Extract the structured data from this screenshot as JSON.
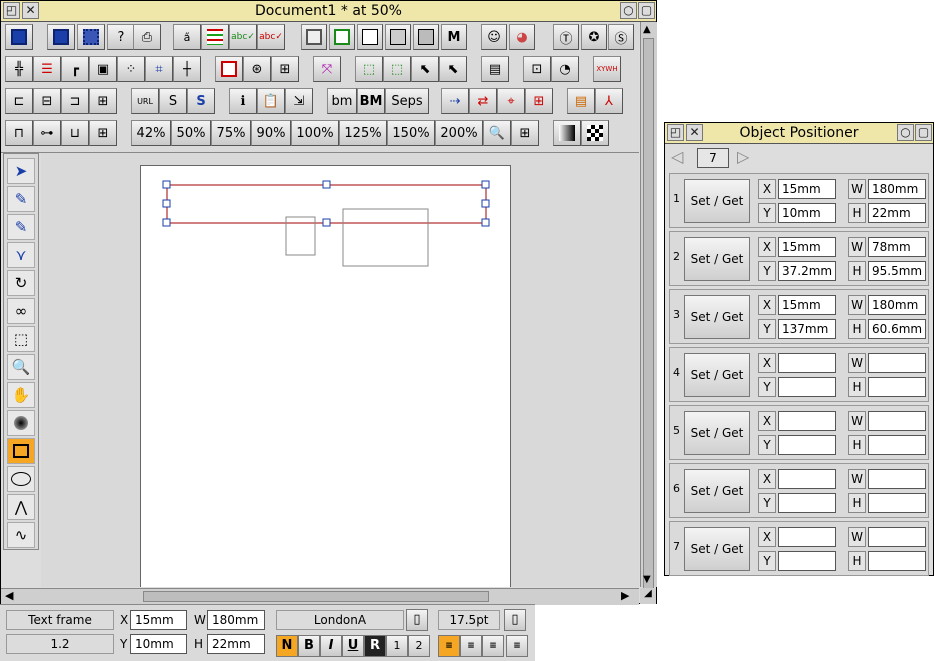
{
  "main_window": {
    "title": "Document1 * at 50%",
    "zoom_buttons": [
      "42%",
      "50%",
      "75%",
      "90%",
      "100%",
      "125%",
      "150%",
      "200%"
    ],
    "text_buttons": [
      "bm",
      "BM",
      "Seps"
    ]
  },
  "info_bar": {
    "object_type": "Text frame",
    "scale": "1.2",
    "x_label": "X",
    "x_value": "15mm",
    "y_label": "Y",
    "y_value": "10mm",
    "w_label": "W",
    "w_value": "180mm",
    "h_label": "H",
    "h_value": "22mm",
    "font": "LondonA",
    "size": "17.5pt",
    "style_buttons": [
      "N",
      "B",
      "I",
      "U",
      "R",
      "1",
      "2"
    ]
  },
  "positioner": {
    "title": "Object Positioner",
    "page": "7",
    "set_get_label": "Set / Get",
    "rows": [
      {
        "num": "1",
        "x": "15mm",
        "y": "10mm",
        "w": "180mm",
        "h": "22mm"
      },
      {
        "num": "2",
        "x": "15mm",
        "y": "37.2mm",
        "w": "78mm",
        "h": "95.5mm"
      },
      {
        "num": "3",
        "x": "15mm",
        "y": "137mm",
        "w": "180mm",
        "h": "60.6mm"
      },
      {
        "num": "4",
        "x": "",
        "y": "",
        "w": "",
        "h": ""
      },
      {
        "num": "5",
        "x": "",
        "y": "",
        "w": "",
        "h": ""
      },
      {
        "num": "6",
        "x": "",
        "y": "",
        "w": "",
        "h": ""
      },
      {
        "num": "7",
        "x": "",
        "y": "",
        "w": "",
        "h": ""
      }
    ],
    "labels": {
      "x": "X",
      "y": "Y",
      "w": "W",
      "h": "H"
    }
  }
}
